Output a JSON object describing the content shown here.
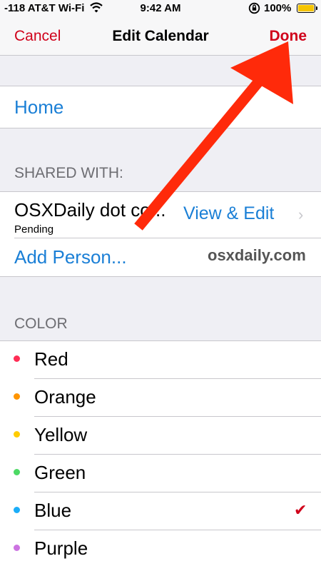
{
  "status_bar": {
    "carrier": "-118 AT&T Wi-Fi",
    "time": "9:42 AM",
    "battery": "100%",
    "icons": [
      "wifi-icon",
      "orientation-lock-icon",
      "battery-icon"
    ]
  },
  "nav": {
    "cancel_label": "Cancel",
    "title": "Edit Calendar",
    "done_label": "Done"
  },
  "calendar": {
    "name": "Home"
  },
  "shared": {
    "header": "SHARED WITH:",
    "person_name": "OSXDaily dot co...",
    "person_status": "Pending",
    "access_label": "View & Edit",
    "add_label": "Add Person...",
    "watermark": "osxdaily.com"
  },
  "color": {
    "header": "COLOR",
    "selected": "Blue",
    "options": [
      {
        "name": "Red",
        "dot": "#ff2d55"
      },
      {
        "name": "Orange",
        "dot": "#ff9500"
      },
      {
        "name": "Yellow",
        "dot": "#ffcc00"
      },
      {
        "name": "Green",
        "dot": "#4cd964"
      },
      {
        "name": "Blue",
        "dot": "#1badf8"
      },
      {
        "name": "Purple",
        "dot": "#cc73e1"
      }
    ]
  },
  "colors": {
    "accent_red": "#d0021b",
    "link_blue": "#1a7fd6",
    "annotation_arrow": "#ff2a0a"
  }
}
